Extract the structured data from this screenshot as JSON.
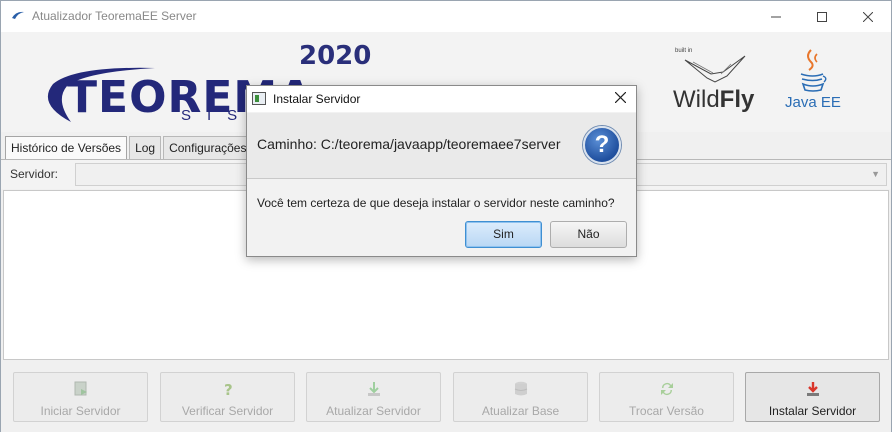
{
  "window": {
    "title": "Atualizador TeoremaEE Server",
    "controls": {
      "minimize": "—",
      "maximize": "☐",
      "close": "✕"
    }
  },
  "banner": {
    "logo_year": "2020",
    "logo_name": "TEOREMA",
    "logo_sub": "SISTEMAS",
    "wildfly_builtin": "built in",
    "wildfly_name_light": "Wild",
    "wildfly_name_bold": "Fly",
    "javaee_text": "Java EE"
  },
  "tabs": [
    {
      "label": "Histórico de Versões",
      "active": true
    },
    {
      "label": "Log",
      "active": false
    },
    {
      "label": "Configurações",
      "active": false
    }
  ],
  "server": {
    "label": "Servidor:",
    "selected_value": ""
  },
  "actions": [
    {
      "label": "Iniciar Servidor",
      "icon": "start-server-icon",
      "enabled": false
    },
    {
      "label": "Verificar Servidor",
      "icon": "question-icon",
      "enabled": false
    },
    {
      "label": "Atualizar Servidor",
      "icon": "download-icon",
      "enabled": false
    },
    {
      "label": "Atualizar Base",
      "icon": "database-icon",
      "enabled": false
    },
    {
      "label": "Trocar Versão",
      "icon": "refresh-icon",
      "enabled": false
    },
    {
      "label": "Instalar Servidor",
      "icon": "install-icon",
      "enabled": true
    }
  ],
  "dialog": {
    "title": "Instalar Servidor",
    "close": "✕",
    "path_text": "Caminho: C:/teorema/javaapp/teoremaee7server",
    "question_mark": "?",
    "question": "Você tem certeza de que deseja instalar o servidor neste caminho?",
    "yes_label": "Sim",
    "no_label": "Não"
  },
  "colors": {
    "brand_navy": "#23287a",
    "accent_blue": "#3f8fd2",
    "javaee_blue": "#2a6db5",
    "disabled_text": "#a8a8a8"
  }
}
